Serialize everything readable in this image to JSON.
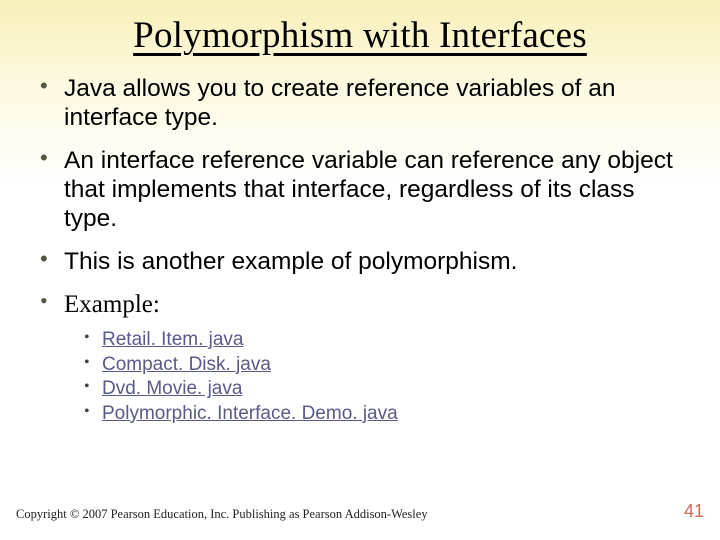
{
  "title": "Polymorphism with Interfaces",
  "bullets": [
    {
      "text": "Java allows you to create reference variables of an interface type."
    },
    {
      "text": "An interface reference variable can reference any object that implements that interface, regardless of its class type."
    },
    {
      "text": "This is another example of polymorphism."
    },
    {
      "text": "Example:",
      "tnr": true
    }
  ],
  "examples": [
    "Retail. Item. java",
    "Compact. Disk. java",
    "Dvd. Movie. java",
    "Polymorphic. Interface. Demo. java"
  ],
  "copyright": "Copyright © 2007 Pearson Education, Inc. Publishing as Pearson Addison-Wesley",
  "page_number": "41"
}
